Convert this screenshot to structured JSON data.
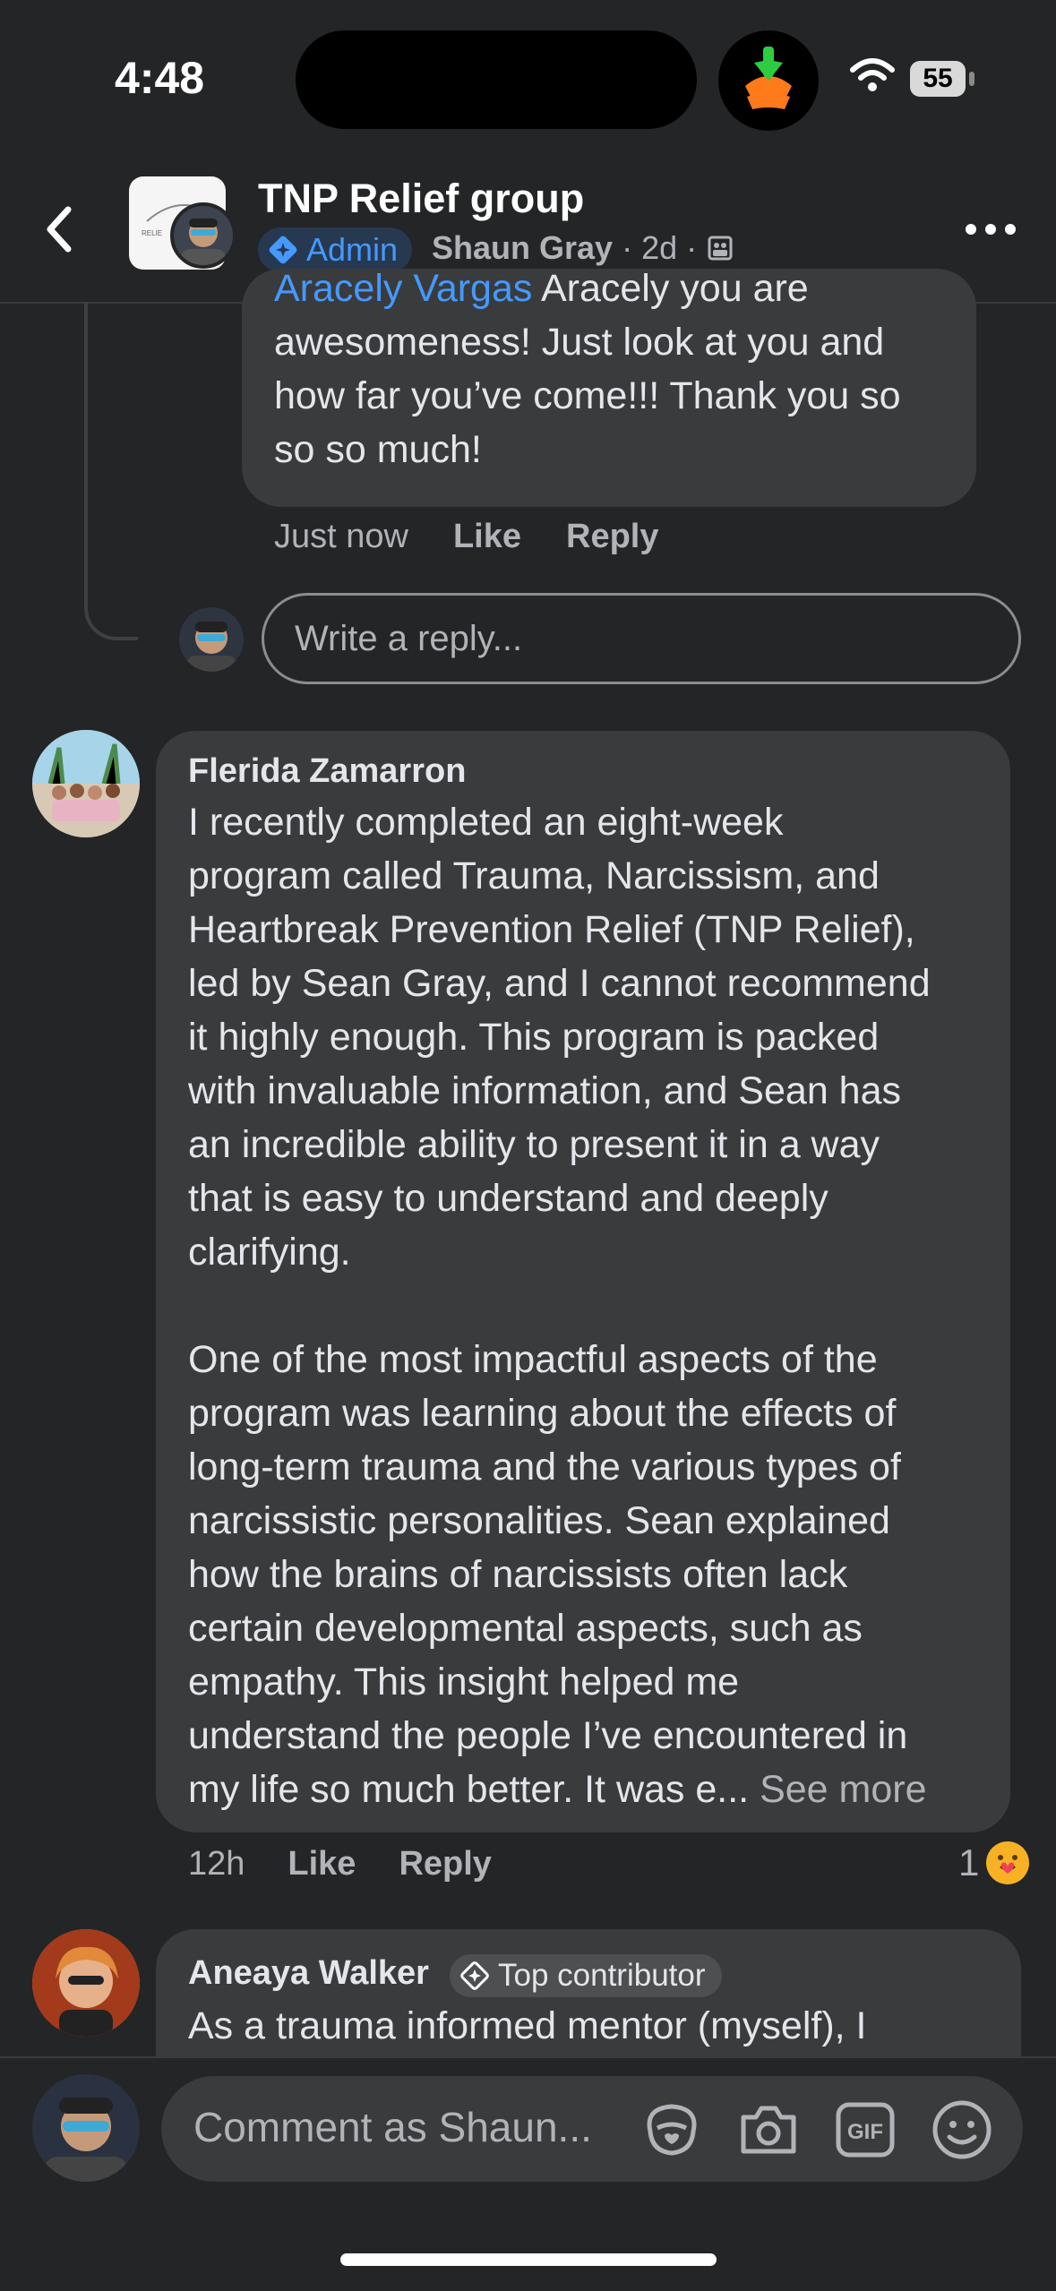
{
  "status_bar": {
    "time": "4:48",
    "battery": "55"
  },
  "header": {
    "title": "TNP Relief group",
    "admin_badge": "Admin",
    "author": "Shaun Gray",
    "sep1": "·",
    "age": "2d",
    "sep2": "·"
  },
  "reply": {
    "mention": "Aracely Vargas",
    "text": " Aracely you are\nawesomeness! Just look at you and\nhow far you’ve come!!! Thank you so\nso so much!",
    "time": "Just now",
    "like": "Like",
    "reply": "Reply"
  },
  "reply_box": {
    "placeholder": "Write a reply..."
  },
  "comments": [
    {
      "author": "Flerida Zamarron",
      "text": "I recently completed an eight-week\nprogram called Trauma, Narcissism, and\nHeartbreak Prevention Relief (TNP Relief),\nled by Sean Gray, and I cannot recommend\nit highly enough. This program is packed\nwith invaluable information, and Sean has\nan incredible ability to present it in a way\nthat is easy to understand and deeply\nclarifying.\n\nOne of the most impactful aspects of the\nprogram was learning about the effects of\nlong-term trauma and the various types of\nnarcissistic personalities. Sean explained\nhow the brains of narcissists often lack\ncertain developmental aspects, such as\nempathy. This insight helped me\nunderstand the people I’ve encountered in\nmy life so much better. It was e... ",
      "see_more": "See more",
      "time": "12h",
      "like": "Like",
      "reply": "Reply",
      "reaction_count": "1"
    },
    {
      "author": "Aneaya Walker",
      "badge": "Top contributor",
      "text": "As a trauma informed mentor (myself), I"
    }
  ],
  "composer": {
    "placeholder": "Comment as Shaun...",
    "icons": [
      "avatar-sticker-icon",
      "camera-icon",
      "gif-icon",
      "emoji-icon"
    ]
  },
  "colors": {
    "background": "#242526",
    "bubble": "#3a3b3c",
    "link": "#4599ff",
    "muted": "#b0b3b8"
  }
}
